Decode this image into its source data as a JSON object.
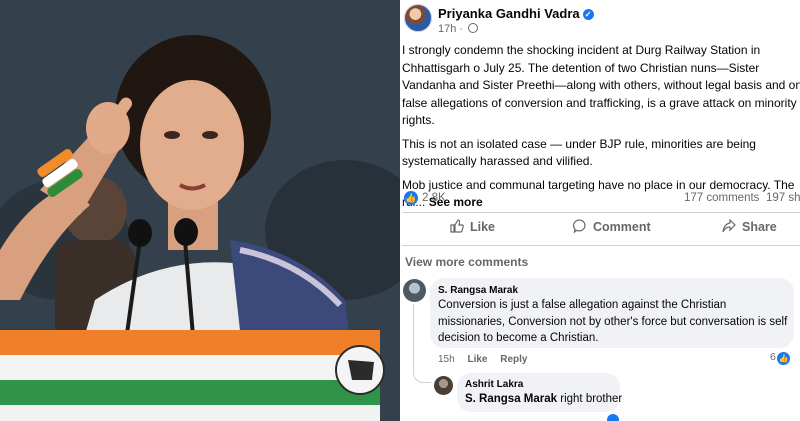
{
  "post": {
    "author": "Priyanka Gandhi Vadra",
    "verified_icon": "verified-badge-icon",
    "time": "17h",
    "visibility_icon": "globe-icon",
    "paragraphs": [
      "I strongly condemn the shocking incident at Durg Railway Station in Chhattisgarh o July 25. The detention of two Christian nuns—Sister Vandanha and Sister Preethi—along with others, without legal basis and on false allegations of conversion and trafficking, is a grave attack on minority rights.",
      "This is not an isolated case — under BJP rule, minorities are being systematically harassed and vilified."
    ],
    "truncated_text": "Mob justice and communal targeting have no place in our democracy. The rul...",
    "see_more": "See more",
    "reactions_count": "2.8K",
    "comments_count": "177 comments",
    "shares_count": "197 sha"
  },
  "actions": {
    "like": "Like",
    "comment": "Comment",
    "share": "Share"
  },
  "comments": {
    "view_more": "View more comments",
    "items": [
      {
        "name": "S. Rangsa Marak",
        "text": "Conversion is just a false allegation against the Christian missionaries, Conversion not by other's force but conversation is self decision to become a Christian.",
        "time": "15h",
        "like": "Like",
        "reply": "Reply",
        "reactions": "6"
      },
      {
        "name": "Ashrit Lakra",
        "mention": "S. Rangsa Marak",
        "text": "right brother"
      }
    ]
  },
  "colors": {
    "brand_blue": "#1877f2",
    "secondary_text": "#65676b",
    "comment_bubble": "#f0f2f5"
  }
}
